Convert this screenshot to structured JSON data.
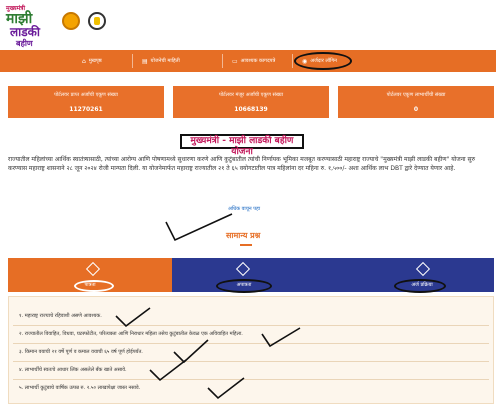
{
  "logo": {
    "line1": "मुख्यमंत्री",
    "line2": "माझी",
    "line3": "लाडकी",
    "line4": "बहीण",
    "tagline": "योजना"
  },
  "nav": {
    "items": [
      {
        "label": "मुखपृष्ठ",
        "icon": "home-icon",
        "glyph": "⌂"
      },
      {
        "label": "योजनेची माहिती",
        "icon": "document-icon",
        "glyph": "▤"
      },
      {
        "label": "आवश्यक कागदपत्रे",
        "icon": "file-icon",
        "glyph": "▭"
      },
      {
        "label": "अर्जदार लॉगिन",
        "icon": "user-icon",
        "glyph": "◉"
      }
    ]
  },
  "stats": [
    {
      "label": "पोर्टलवर प्राप्त अर्जांची एकूण संख्या",
      "value": "11270261"
    },
    {
      "label": "पोर्टलवर मंजूर अर्जांची एकूण संख्या",
      "value": "10668139"
    },
    {
      "label": "पोर्टलवर एकूण लाभार्थींची संख्या",
      "value": "0"
    }
  ],
  "page_title": "मुख्यमंत्री - माझी लाडकी बहीण योजना",
  "intro": "राज्यातील महिलांच्या आर्थिक स्वातंत्र्यासाठी, त्यांच्या आरोग्य आणि पोषणामध्ये सुधारणा करणे आणि कुटुंबातील त्यांची निर्णायक भूमिका मजबूत करण्यासाठी महाराष्ट्र राज्याचे \"मुख्यमंत्री माझी लाडकी बहीण\" योजना सुरु करण्यास महाराष्ट्र शासनाने २८ जून २०२४ रोजी मान्यता दिली. या योजनेमार्फत महाराष्ट्र राज्यातील २१ ते ६५ वयोगटातील पात्र महिलांना दर महिना रु. १,५००/- अशा आर्थिक लाभ DBT द्वारे देण्यात येणार आहे.",
  "read_more": "अधिक वाचून पहा",
  "faq_heading": "सामान्य प्रश्न",
  "tabs": [
    {
      "label": "पात्रता",
      "icon": "eligibility-icon"
    },
    {
      "label": "अपात्रता",
      "icon": "ineligibility-icon"
    },
    {
      "label": "अर्ज प्रक्रिया",
      "icon": "application-process-icon"
    }
  ],
  "criteria": [
    "१. महाराष्ट्र राज्याचे रहिवाशी असणे आवश्यक.",
    "२. राज्यातील विवाहित, विधवा, घटस्फोटीत, परित्यक्ता आणि निराधार महिला तसेच कुटुंबातील केवळ एक अविवाहित महिला.",
    "३. किमान वयाची २१ वर्षे पूर्ण व कमाल वयाची ६५ वर्ष पूर्ण होईपर्यंत.",
    "४. लाभार्थींचे स्वतःचे आधार लिंक असलेले बँक खाते असावे.",
    "५. लाभार्थी कुटुंबाचे वार्षिक उत्पन्न रु. २.५० लाखापेक्षा जास्त नसावे."
  ],
  "colors": {
    "accent_orange": "#e66e25",
    "navy": "#2b3990",
    "title_pink": "#c2185b"
  }
}
